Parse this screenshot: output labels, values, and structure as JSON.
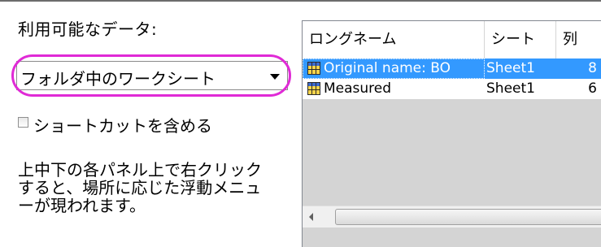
{
  "left_panel": {
    "available_label": "利用可能なデータ:",
    "folder_select": {
      "selected": "フォルダ中のワークシート"
    },
    "shortcut_checkbox": {
      "label": "ショートカットを含める",
      "checked": false
    },
    "help_lines": [
      "上中下の各パネル上で右クリック",
      "すると、場所に応じた浮動メニュ",
      "ーが現われます。"
    ]
  },
  "table": {
    "columns": [
      "ロングネーム",
      "シート",
      "列"
    ],
    "rows": [
      {
        "name": "Original name: BO",
        "sheet": "Sheet1",
        "cols": "8",
        "selected": true,
        "icon": "worksheet-icon"
      },
      {
        "name": "Measured",
        "sheet": "Sheet1",
        "cols": "6",
        "selected": false,
        "icon": "worksheet-icon"
      }
    ]
  },
  "colors": {
    "highlight_ring": "#e02ad6",
    "selection": "#3399ff"
  }
}
